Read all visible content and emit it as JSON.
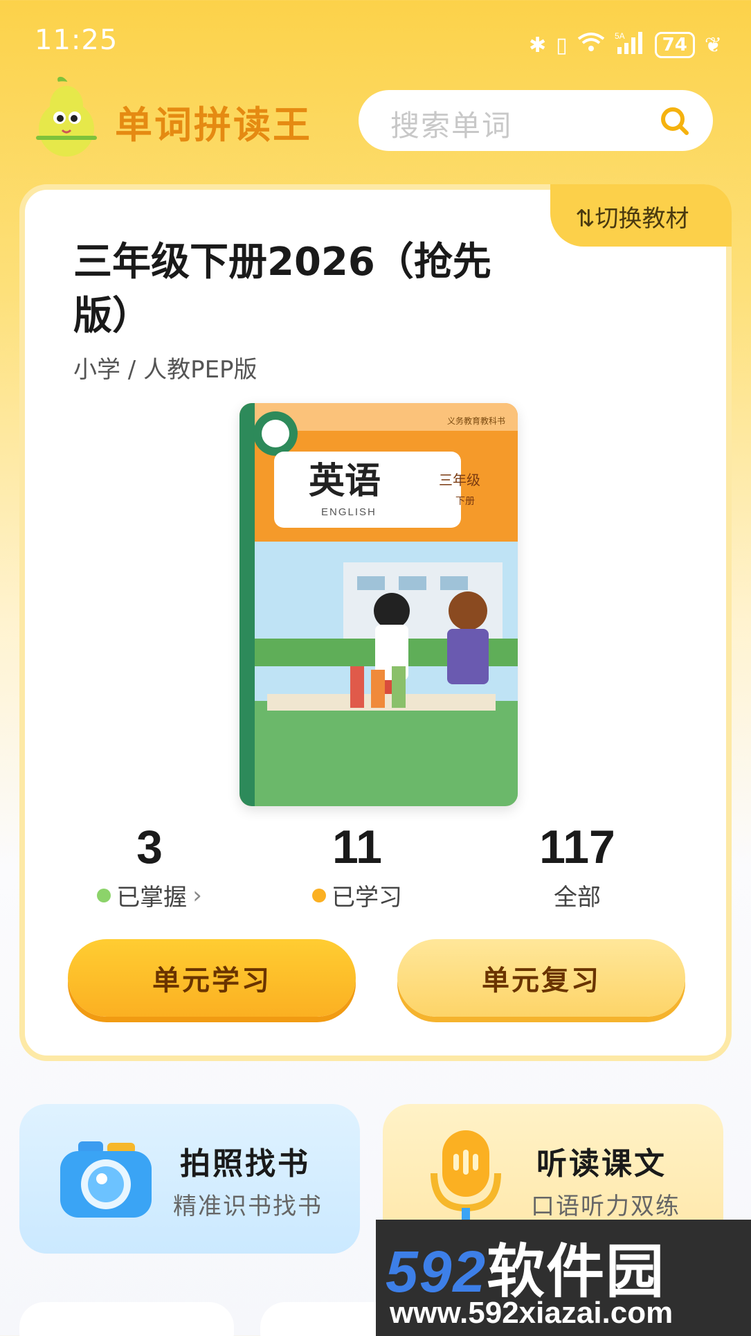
{
  "status_bar": {
    "time": "11:25",
    "battery": "74",
    "network": "5A"
  },
  "header": {
    "app_title": "单词拼读王",
    "search_placeholder": "搜索单词"
  },
  "book_card": {
    "switch_label": "切换教材",
    "title": "三年级下册2026（抢先版）",
    "subtitle": "小学 / 人教PEP版",
    "cover": {
      "title": "英语",
      "subtitle": "ENGLISH",
      "grade": "三年级",
      "term": "下册",
      "series": "义务教育教科书"
    },
    "stats": [
      {
        "value": "3",
        "label": "已掌握",
        "dot_color": "#8cd36a",
        "chevron": "›"
      },
      {
        "value": "11",
        "label": "已学习",
        "dot_color": "#fbb022"
      },
      {
        "value": "117",
        "label": "全部"
      }
    ],
    "buttons": {
      "learn": "单元学习",
      "review": "单元复习"
    }
  },
  "features": [
    {
      "title": "拍照找书",
      "subtitle": "精准识书找书",
      "icon": "camera-icon"
    },
    {
      "title": "听读课文",
      "subtitle": "口语听力双练",
      "icon": "microphone-icon"
    }
  ],
  "watermark": {
    "number": "592",
    "name": "软件园",
    "url": "www.592xiazai.com"
  },
  "colors": {
    "accent": "#fcd04a",
    "title_orange": "#e58a12",
    "button_text": "#6a3400"
  }
}
